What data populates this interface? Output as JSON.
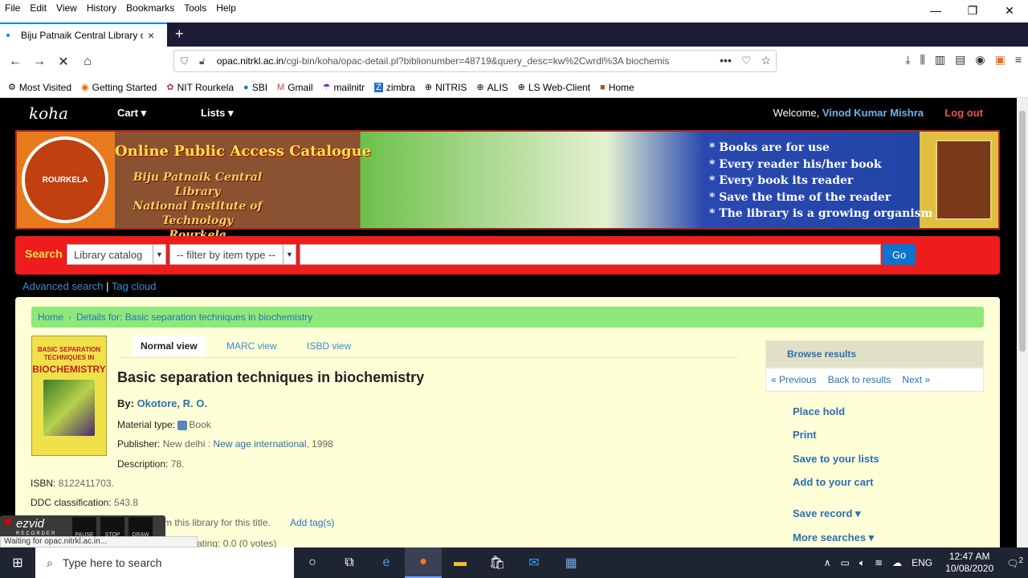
{
  "menubar": {
    "items": [
      "File",
      "Edit",
      "View",
      "History",
      "Bookmarks",
      "Tools",
      "Help"
    ]
  },
  "window_controls": {
    "minimize": "—",
    "restore": "❐",
    "close": "✕"
  },
  "tab": {
    "title": "Biju Patnaik Central Library cat",
    "close": "×",
    "new_tab": "+"
  },
  "nav": {
    "back": "←",
    "forward": "→",
    "stop": "✕",
    "home": "⌂"
  },
  "url": {
    "host": "opac.nitrkl.ac.in",
    "path": "/cgi-bin/koha/opac-detail.pl?biblionumber=48719&query_desc=kw%2Cwrdl%3A biochemis",
    "more": "•••"
  },
  "bookmarks": [
    {
      "icon": "⚙",
      "label": "Most Visited"
    },
    {
      "icon": "◉",
      "label": "Getting Started"
    },
    {
      "icon": "✿",
      "label": "NIT Rourkela"
    },
    {
      "icon": "●",
      "label": "SBI"
    },
    {
      "icon": "M",
      "label": "Gmail"
    },
    {
      "icon": "☂",
      "label": "mailnitr"
    },
    {
      "icon": "Z",
      "label": "zimbra"
    },
    {
      "icon": "⊕",
      "label": "NITRIS"
    },
    {
      "icon": "⊕",
      "label": "ALIS"
    },
    {
      "icon": "⊕",
      "label": "LS Web-Client"
    },
    {
      "icon": "■",
      "label": "Home"
    }
  ],
  "koha": {
    "logo": "koha",
    "cart": "Cart ▾",
    "lists": "Lists ▾",
    "welcome_prefix": "Welcome, ",
    "welcome_user": "Vinod Kumar Mishra",
    "logout": "Log out"
  },
  "banner": {
    "seal": "ROURKELA",
    "heading": "Online Public Access Catalogue",
    "library_lines": [
      "Biju Patnaik Central Library",
      "National Institute of Technology",
      "Rourkela"
    ],
    "mottos": [
      "* Books are for use",
      "* Every reader his/her book",
      "* Every book its reader",
      "* Save the time of the reader",
      "* The library is a growing organism"
    ]
  },
  "search": {
    "label": "Search",
    "scope": "Library catalog",
    "filter": "-- filter by item type --",
    "go": "Go",
    "advanced": "Advanced search",
    "divider": "|",
    "tag_cloud": "Tag cloud"
  },
  "breadcrumb": {
    "home": "Home",
    "sep": "›",
    "current": "Details for: Basic separation techniques in biochemistry"
  },
  "cover": {
    "title_lines": "BASIC SEPARATION TECHNIQUES IN",
    "big": "BIOCHEMISTRY"
  },
  "views": {
    "normal": "Normal view",
    "marc": "MARC view",
    "isbd": "ISBD view"
  },
  "record": {
    "title": "Basic separation techniques in biochemistry",
    "by_label": "By: ",
    "author": "Okotore, R. O.",
    "material_label": "Material type: ",
    "material_value": "Book",
    "publisher_label": "Publisher: ",
    "publisher_place": "New delhi : ",
    "publisher_name": "New age international",
    "publisher_year": ", 1998",
    "description_label": "Description: ",
    "description_value": "78.",
    "isbn_label": "ISBN: ",
    "isbn_value": "8122411703.",
    "ddc_label": "DDC classification: ",
    "ddc_value": "543.8",
    "tags_text": "m this library for this title.",
    "add_tags": "Add tag(s)",
    "rating": "ating: 0.0 (0 votes)"
  },
  "sidebar": {
    "browse": "Browse results",
    "prev": "« Previous",
    "back": "Back to results",
    "next": "Next »",
    "actions": [
      "Place hold",
      "Print",
      "Save to your lists",
      "Add to your cart",
      "Save record ▾",
      "More searches ▾"
    ]
  },
  "ezvid": {
    "logo": "ezvid",
    "sub": "RECORDER",
    "pause": "PAUSE",
    "stop": "STOP",
    "draw": "DRAW"
  },
  "status_text": "Waiting for opac.nitrkl.ac.in...",
  "taskbar": {
    "search_placeholder": "Type here to search",
    "lang": "ENG",
    "time": "12:47 AM",
    "date": "10/08/2020",
    "notif": "2"
  }
}
